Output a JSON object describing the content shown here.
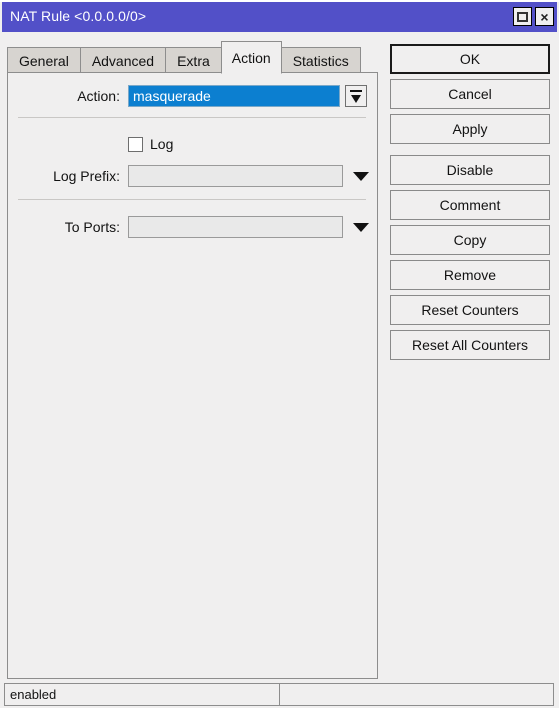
{
  "window": {
    "title": "NAT Rule <0.0.0.0/0>",
    "titlebar_color": "#5250c8",
    "maximize_icon": "maximize-icon",
    "close_icon": "close-icon",
    "close_glyph": "×"
  },
  "tabs": [
    {
      "label": "General",
      "active": false
    },
    {
      "label": "Advanced",
      "active": false
    },
    {
      "label": "Extra",
      "active": false
    },
    {
      "label": "Action",
      "active": true
    },
    {
      "label": "Statistics",
      "active": false
    }
  ],
  "form": {
    "action": {
      "label": "Action:",
      "value": "masquerade",
      "selected": true,
      "selection_color": "#0c7fd0",
      "dropdown_icon": "dropdown-bar-arrow-icon"
    },
    "log": {
      "label": "Log",
      "checked": false
    },
    "log_prefix": {
      "label": "Log Prefix:",
      "value": "",
      "placeholder": "",
      "dropdown_icon": "chevron-down-icon"
    },
    "to_ports": {
      "label": "To Ports:",
      "value": "",
      "placeholder": "",
      "dropdown_icon": "chevron-down-icon"
    }
  },
  "buttons": [
    {
      "label": "OK",
      "primary": true,
      "gap": false
    },
    {
      "label": "Cancel",
      "primary": false,
      "gap": false
    },
    {
      "label": "Apply",
      "primary": false,
      "gap": false
    },
    {
      "label": "Disable",
      "primary": false,
      "gap": true
    },
    {
      "label": "Comment",
      "primary": false,
      "gap": false
    },
    {
      "label": "Copy",
      "primary": false,
      "gap": false
    },
    {
      "label": "Remove",
      "primary": false,
      "gap": false
    },
    {
      "label": "Reset Counters",
      "primary": false,
      "gap": false
    },
    {
      "label": "Reset All Counters",
      "primary": false,
      "gap": false
    }
  ],
  "statusbar": {
    "left": "enabled",
    "right": ""
  }
}
